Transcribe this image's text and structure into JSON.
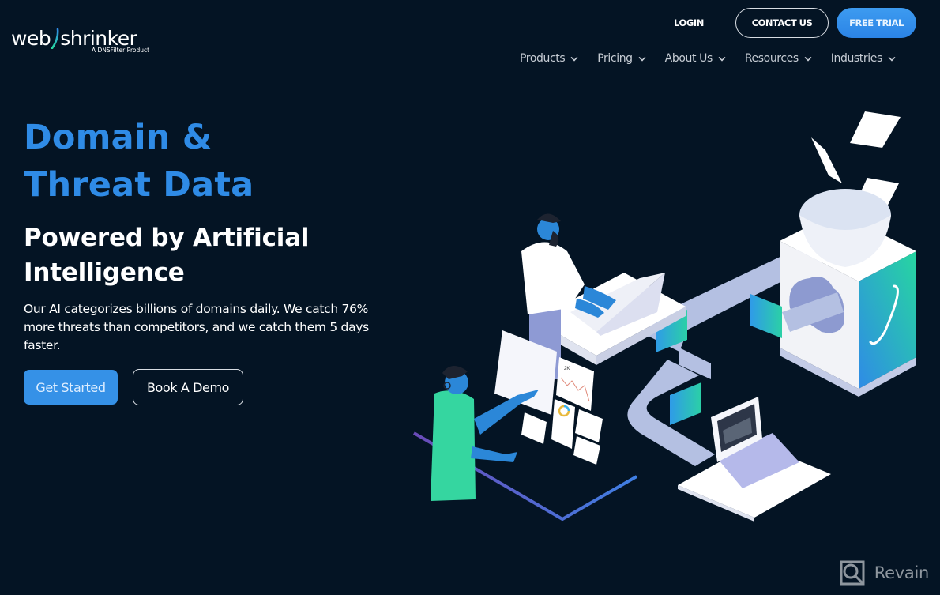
{
  "brand": {
    "name_left": "web",
    "name_right": "shrinker",
    "tagline": "A DNSFilter Product",
    "colors": {
      "background": "#041424",
      "accent_blue": "#2f8be6",
      "button_blue": "#3591e7",
      "teal": "#27d6a0",
      "nav_text": "#c6ccd4"
    }
  },
  "header": {
    "login_label": "LOGIN",
    "contact_label": "CONTACT US",
    "trial_label": "FREE TRIAL",
    "nav": [
      {
        "label": "Products",
        "icon": "chevron-down-icon"
      },
      {
        "label": "Pricing",
        "icon": "chevron-down-icon"
      },
      {
        "label": "About Us",
        "icon": "chevron-down-icon"
      },
      {
        "label": "Resources",
        "icon": "chevron-down-icon"
      },
      {
        "label": "Industries",
        "icon": "chevron-down-icon"
      }
    ]
  },
  "hero": {
    "title_line1": "Domain &",
    "title_line2": "Threat Data",
    "subtitle_line1": "Powered by Artificial",
    "subtitle_line2": "Intelligence",
    "description": "Our AI categorizes billions of domains daily. We catch 76% more threats than competitors, and we catch them 5 days faster.",
    "primary_cta": "Get Started",
    "secondary_cta": "Book A Demo",
    "illustration": {
      "alt": "isometric data processing illustration",
      "chart_label": "2K"
    }
  },
  "watermark": {
    "label": "Revain",
    "icon": "revain-logo-icon"
  }
}
